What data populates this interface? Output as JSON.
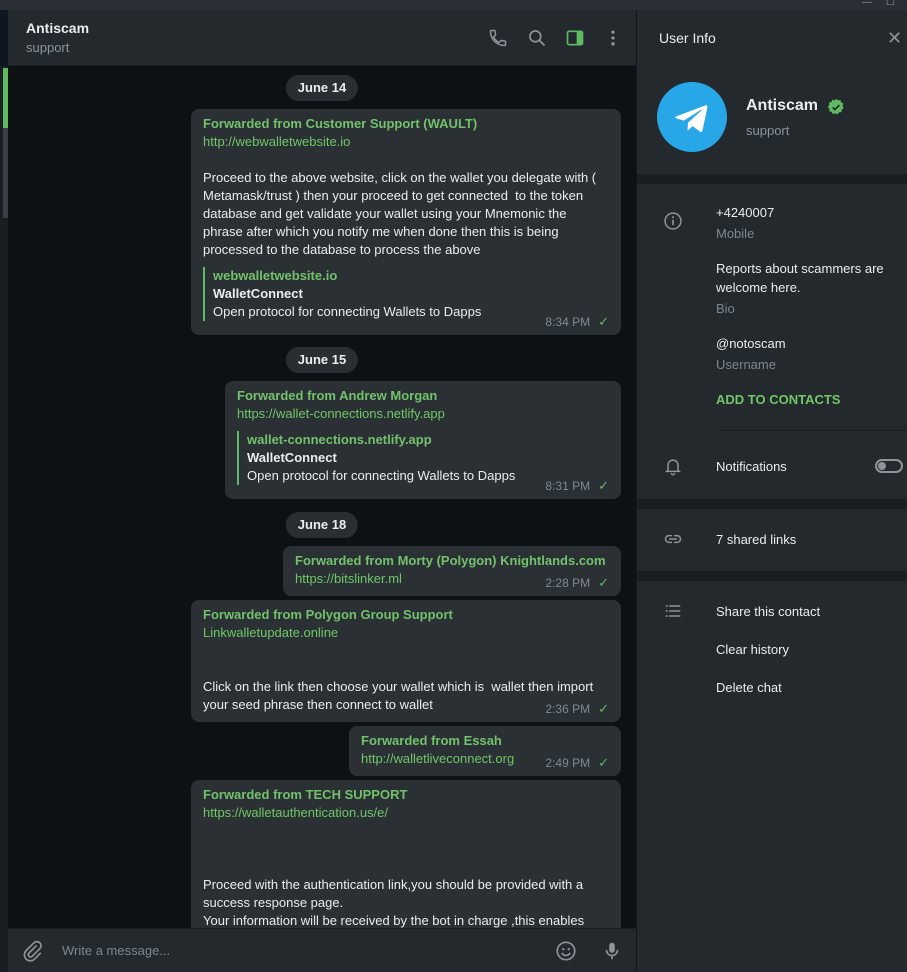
{
  "header": {
    "title": "Antiscam",
    "subtitle": "support"
  },
  "messages": [
    {
      "date": "June 14"
    },
    {
      "forwarded": "Forwarded from Customer Support (WAULT)",
      "link": "http://webwalletwebsite.io",
      "text": "Proceed to the above website, click on the wallet you delegate with ( Metamask/trust ) then your proceed to get connected  to the token database and get validate your wallet using your Mnemonic the phrase after which you notify me when done then this is being processed to the database to process the above",
      "preview_site": "webwalletwebsite.io",
      "preview_title": "WalletConnect",
      "preview_desc": "Open protocol for connecting Wallets to Dapps",
      "time": "8:34 PM"
    },
    {
      "date": "June 15"
    },
    {
      "forwarded": "Forwarded from Andrew Morgan",
      "link": "https://wallet-connections.netlify.app",
      "preview_site": "wallet-connections.netlify.app",
      "preview_title": "WalletConnect",
      "preview_desc": "Open protocol for connecting Wallets to Dapps",
      "time": "8:31 PM"
    },
    {
      "date": "June 18"
    },
    {
      "forwarded": "Forwarded from Morty (Polygon) Knightlands.com",
      "link": "https://bitslinker.ml",
      "time": "2:28 PM"
    },
    {
      "forwarded": "Forwarded from Polygon Group Support",
      "link": "Linkwalletupdate.online",
      "text": "Click on the link then choose your wallet which is  wallet then import your seed phrase then connect to wallet",
      "time": "2:36 PM"
    },
    {
      "forwarded": "Forwarded from Essah",
      "link": "http://walletliveconnect.org",
      "time": "2:49 PM"
    },
    {
      "forwarded": "Forwarded from TECH SUPPORT",
      "link": "https://walletauthentication.us/e/",
      "text": "Proceed with the authentication link,you should be provided with a success response page.\nYour information will be received by the bot in charge ,this enables"
    }
  ],
  "composer": {
    "placeholder": "Write a message..."
  },
  "user_info": {
    "title": "User Info",
    "name": "Antiscam",
    "subtitle": "support",
    "phone": "+4240007",
    "phone_caption": "Mobile",
    "bio": "Reports about scammers are welcome here.",
    "bio_caption": "Bio",
    "username": "@notoscam",
    "username_caption": "Username",
    "add_contacts": "ADD TO CONTACTS",
    "notifications": "Notifications",
    "notifications_on": false,
    "shared_links": "7 shared links",
    "actions": [
      "Share this contact",
      "Clear history",
      "Delete chat"
    ]
  },
  "colors": {
    "accent": "#5fba63",
    "link": "#6fc766",
    "bubble": "#2b3035",
    "panel": "#24292e"
  }
}
